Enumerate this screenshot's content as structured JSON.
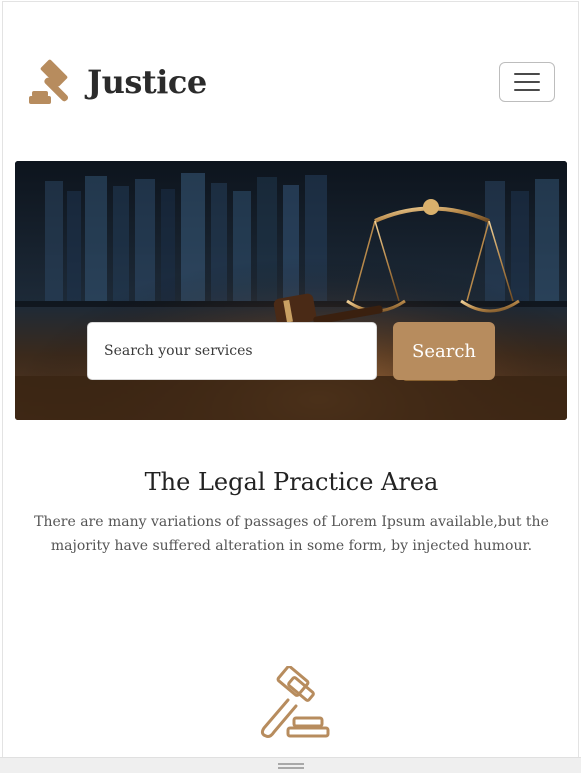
{
  "brand": {
    "name": "Justice",
    "logo_icon": "gavel-icon",
    "accent_color": "#b78c5e"
  },
  "nav": {
    "toggle_icon": "hamburger-menu-icon"
  },
  "hero": {
    "image": "scales-of-justice-and-gavel-on-desk",
    "search": {
      "placeholder": "Search your services",
      "value": "",
      "button_label": "Search"
    }
  },
  "practice": {
    "title": "The Legal Practice Area",
    "text": "There are many variations of passages of Lorem Ipsum available,but the majority have suffered alteration in some form, by injected humour.",
    "icon": "gavel-outline-icon"
  },
  "colors": {
    "accent": "#b78c5e",
    "heading": "#222222",
    "body_text": "#555555"
  }
}
